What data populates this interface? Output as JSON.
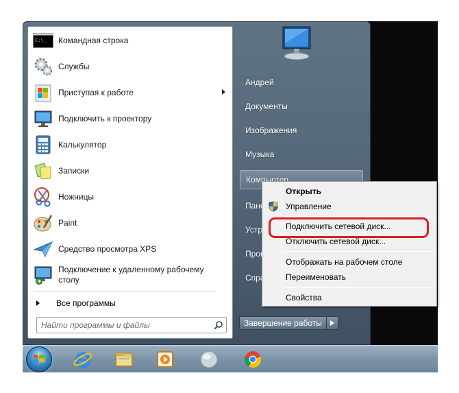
{
  "start_menu": {
    "programs": [
      {
        "label": "Командная строка",
        "icon": "command-prompt-icon",
        "name": "cmd"
      },
      {
        "label": "Службы",
        "icon": "services-gears-icon",
        "name": "services"
      },
      {
        "label": "Приступая к работе",
        "icon": "getting-started-icon",
        "name": "getting-started",
        "submenu": true
      },
      {
        "label": "Подключить к проектору",
        "icon": "projector-monitor-icon",
        "name": "projector"
      },
      {
        "label": "Калькулятор",
        "icon": "calculator-icon",
        "name": "calculator"
      },
      {
        "label": "Записки",
        "icon": "sticky-notes-icon",
        "name": "sticky-notes"
      },
      {
        "label": "Ножницы",
        "icon": "scissors-icon",
        "name": "snipping-tool"
      },
      {
        "label": "Paint",
        "icon": "paint-palette-icon",
        "name": "paint"
      },
      {
        "label": "Средство просмотра XPS",
        "icon": "xps-viewer-icon",
        "name": "xps-viewer"
      },
      {
        "label": "Подключение к удаленному рабочему столу",
        "line1": "Подключение к удаленному рабочему",
        "line2": "столу",
        "icon": "remote-desktop-icon",
        "name": "remote-desktop"
      }
    ],
    "all_programs": "Все программы",
    "search_placeholder": "Найти программы и файлы",
    "right_items": [
      "Андрей",
      "Документы",
      "Изображения",
      "Музыка",
      "Компьютер",
      "Пане",
      "Устр",
      "Прог",
      "Спра"
    ],
    "shutdown_label": "Завершение работы"
  },
  "context_menu": {
    "items": [
      "Открыть",
      "Управление",
      "Подключить сетевой диск...",
      "Отключить сетевой диск...",
      "Отображать на рабочем столе",
      "Переименовать",
      "Свойства"
    ],
    "default_item": "Открыть",
    "highlighted_item": "Подключить сетевой диск..."
  },
  "taskbar": {
    "pinned": [
      "windows-start-orb-icon",
      "internet-explorer-icon",
      "file-explorer-folder-icon",
      "media-player-icon",
      "generic-app-icon",
      "chrome-icon"
    ]
  },
  "colors": {
    "highlight_ring": "#d91f1f",
    "menu_blue_gray": "#56697a"
  }
}
